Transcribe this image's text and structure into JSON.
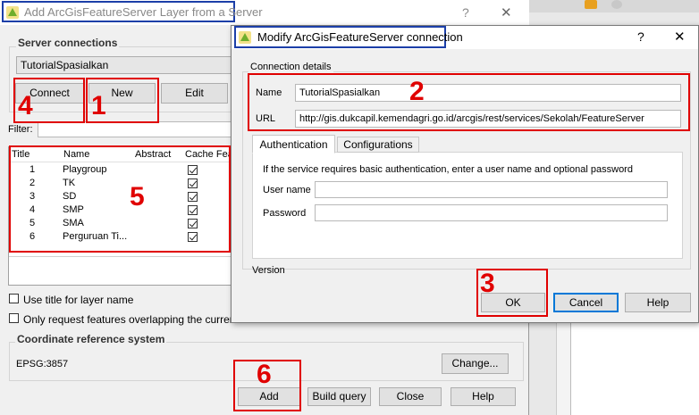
{
  "back_dialog": {
    "title": "Add ArcGisFeatureServer Layer from a Server",
    "help": "?",
    "close": "✕",
    "server_connections_label": "Server connections",
    "selected_connection": "TutorialSpasialkan",
    "connect_button": "Connect",
    "new_button": "New",
    "edit_button": "Edit",
    "filter_label": "Filter:",
    "columns": [
      "Title",
      "Name",
      "Abstract",
      "Cache Fea"
    ],
    "layers": [
      {
        "title": "1",
        "name": "Playgroup",
        "cached": true
      },
      {
        "title": "2",
        "name": "TK",
        "cached": true
      },
      {
        "title": "3",
        "name": "SD",
        "cached": true
      },
      {
        "title": "4",
        "name": "SMP",
        "cached": true
      },
      {
        "title": "5",
        "name": "SMA",
        "cached": true
      },
      {
        "title": "6",
        "name": "Perguruan Ti...",
        "cached": true
      }
    ],
    "use_title_label": "Use title for layer name",
    "only_request_label": "Only request features overlapping the current v",
    "crs_label": "Coordinate reference system",
    "crs_value": "EPSG:3857",
    "change_button": "Change...",
    "add_button": "Add",
    "build_query_button": "Build query",
    "close_button": "Close",
    "help_button": "Help"
  },
  "modify_dialog": {
    "title": "Modify ArcGisFeatureServer connection",
    "help": "?",
    "close": "✕",
    "group_label": "Connection details",
    "name_label": "Name",
    "name_value": "TutorialSpasialkan",
    "url_label": "URL",
    "url_value": "http://gis.dukcapil.kemendagri.go.id/arcgis/rest/services/Sekolah/FeatureServer",
    "tabs": [
      "Authentication",
      "Configurations"
    ],
    "auth_info": "If the service requires basic authentication, enter a user name and optional password",
    "user_label": "User name",
    "user_value": "",
    "password_label": "Password",
    "password_value": "",
    "version_label": "Version",
    "ok_button": "OK",
    "cancel_button": "Cancel",
    "help_button": "Help"
  },
  "annotations": {
    "n1": "1",
    "n2": "2",
    "n3": "3",
    "n4": "4",
    "n5": "5",
    "n6": "6"
  },
  "colors": {
    "annotation_red": "#e00000",
    "highlight_blue": "#1c3fa8",
    "qgis_green": "#6fae2c"
  }
}
